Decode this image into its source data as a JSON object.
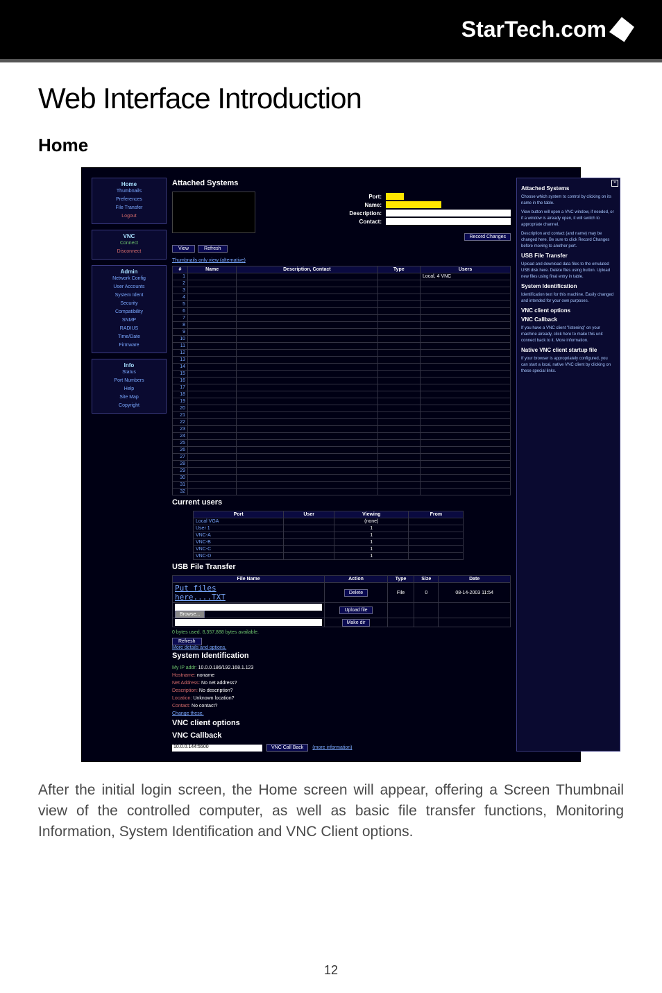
{
  "brand": "StarTech.com",
  "title": "Web Interface Introduction",
  "section": "Home",
  "nav": {
    "group0": {
      "title": "Home",
      "items": [
        "Thumbnails",
        "Preferences",
        "File Transfer"
      ],
      "logout": "Logout"
    },
    "group1": {
      "title": "VNC",
      "connect": "Connect",
      "disconnect": "Disconnect"
    },
    "group2": {
      "title": "Admin",
      "items": [
        "Network Config",
        "User Accounts",
        "System Ident",
        "Security",
        "Compatibility",
        "SNMP",
        "RADIUS",
        "Time/Date",
        "Firmware"
      ]
    },
    "group3": {
      "title": "Info",
      "items": [
        "Status",
        "Port Numbers",
        "Help",
        "Site Map",
        "Copyright"
      ]
    }
  },
  "attached": {
    "heading": "Attached Systems",
    "port_label": "Port:",
    "name_label": "Name:",
    "desc_label": "Description:",
    "contact_label": "Contact:",
    "view": "View",
    "refresh": "Refresh",
    "record": "Record Changes",
    "altlink": "Thumbnails only view (alternative)",
    "cols": {
      "num": "#",
      "name": "Name",
      "desc": "Description,\nContact",
      "type": "Type",
      "users": "Users"
    },
    "row1_users": "Local, 4 VNC",
    "row_count": 32
  },
  "current": {
    "heading": "Current users",
    "cols": {
      "port": "Port",
      "user": "User",
      "viewing": "Viewing",
      "from": "From"
    },
    "rows": [
      {
        "port": "Local VGA",
        "viewing": "(none)"
      },
      {
        "port": "User 1",
        "viewing": "1"
      },
      {
        "port": "VNC-A",
        "viewing": "1"
      },
      {
        "port": "VNC-B",
        "viewing": "1"
      },
      {
        "port": "VNC-C",
        "viewing": "1"
      },
      {
        "port": "VNC-D",
        "viewing": "1"
      }
    ]
  },
  "usb": {
    "heading": "USB File Transfer",
    "cols": {
      "file": "File Name",
      "action": "Action",
      "type": "Type",
      "size": "Size",
      "date": "Date"
    },
    "file1": "Put files",
    "file2": "here....TXT",
    "delete": "Delete",
    "filetype": "File",
    "size": "0",
    "date": "08-14-2003 11:54",
    "browse": "Browse...",
    "upload": "Upload file",
    "makedir": "Make dir",
    "bytes": "0 bytes used. 8,357,888 bytes available.",
    "refresh": "Refresh",
    "more": "More details and options."
  },
  "sysid": {
    "heading": "System Identification",
    "ip_label": "My IP addr:",
    "ip": "10.0.0.186/192.168.1.123",
    "host_label": "Hostname:",
    "host": "noname",
    "net_label": "Net Address:",
    "net": "No net address?",
    "desc_label": "Description:",
    "desc": "No description?",
    "loc_label": "Location:",
    "loc": "Unknown location?",
    "contact_label": "Contact:",
    "contact": "No contact?",
    "change": "Change these."
  },
  "vnc_opt": "VNC client options",
  "vnc_cb": {
    "heading": "VNC Callback",
    "value": "10.0.0.144:5500",
    "button": "VNC Call Back",
    "more": "(more information)"
  },
  "sidebar": {
    "h1": "Attached Systems",
    "p1": "Choose which system to control by clicking on its name in the table.",
    "p2": "View button will open a VNC window, if needed, or if a window is already open, it will switch to appropriate channel.",
    "p3": "Description and contact (and name) may be changed here. Be sure to click Record Changes before moving to another port.",
    "h2": "USB File Transfer",
    "p4": "Upload and download data files to the emulated USB disk here. Delete files using button. Upload new files using final entry in table.",
    "h3": "System Identification",
    "p5": "Identification text for this machine. Easily changed and intended for your own purposes.",
    "h4": "VNC client options",
    "h5": "VNC Callback",
    "p6": "If you have a VNC client \"listening\" on your machine already, click here to make this unit connect back to it. More information.",
    "h6": "Native VNC client startup file",
    "p7": "If your browser is appropriately configured, you can start a local, native VNC client by clicking on these special links."
  },
  "caption": "After the initial login screen, the Home screen will appear, offering a Screen Thumbnail view of the controlled computer, as well as basic file transfer functions, Monitoring Information, System Identification and VNC Client options.",
  "page": "12"
}
